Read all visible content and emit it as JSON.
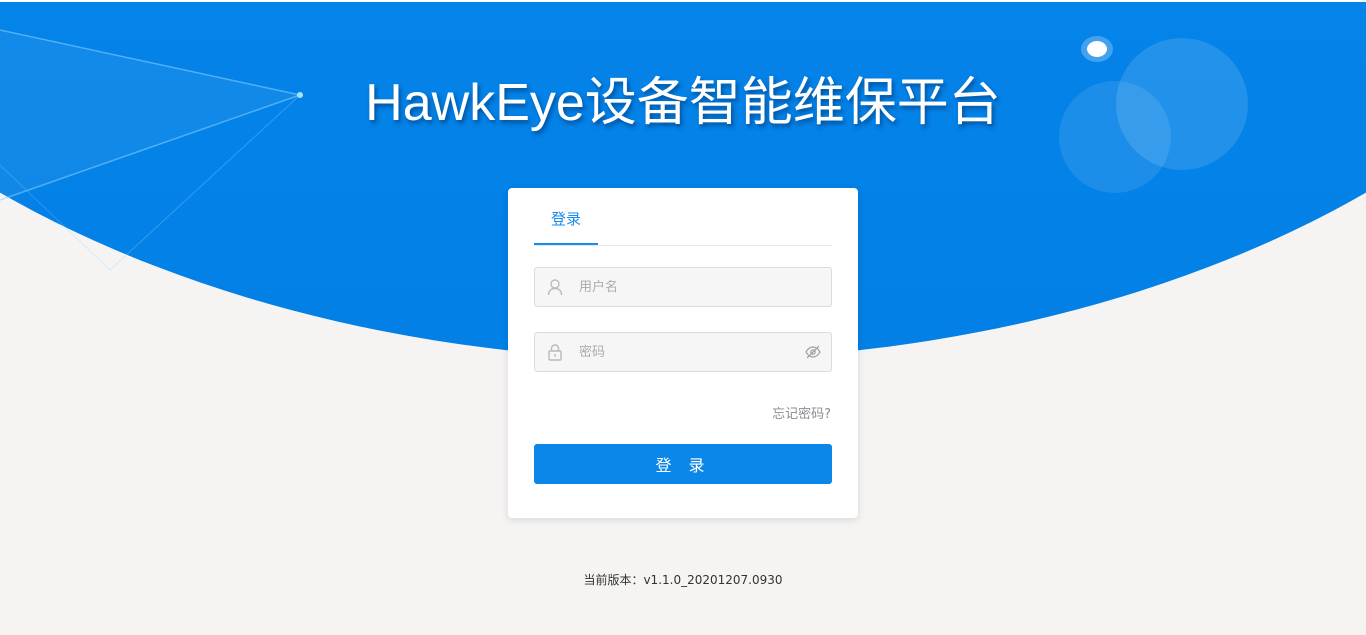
{
  "app": {
    "title": "HawkEye设备智能维保平台"
  },
  "login_card": {
    "tab_label": "登录",
    "username_placeholder": "用户名",
    "username_value": "",
    "password_placeholder": "密码",
    "password_value": "",
    "forgot_label": "忘记密码?",
    "submit_label": "登 录"
  },
  "footer": {
    "version_text": "当前版本：v1.1.0_20201207.0930"
  },
  "icons": {
    "username": "user-icon",
    "password": "lock-icon",
    "toggle": "eye-off-icon"
  },
  "colors": {
    "brand_blue": "#0b87ea",
    "tab_active": "#1a8cf0",
    "background": "#f5f4f3"
  }
}
